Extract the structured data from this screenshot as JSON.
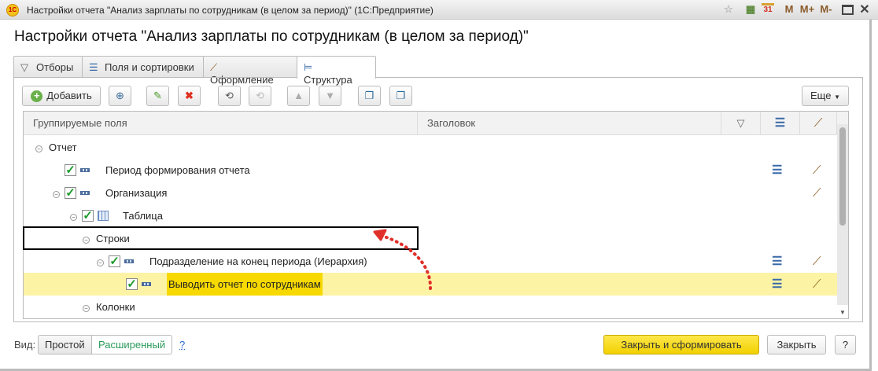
{
  "window": {
    "title": "Настройки отчета \"Анализ зарплаты по сотрудникам (в целом за период)\"  (1С:Предприятие)",
    "logo": "1С",
    "controls": [
      "favorite-icon",
      "calculator-icon",
      "calendar-icon",
      "M",
      "M+",
      "M-",
      "maximize-icon",
      "close-icon"
    ],
    "calendar_day": "31"
  },
  "heading": "Настройки отчета \"Анализ зарплаты по сотрудникам (в целом за период)\"",
  "tabs": [
    {
      "label": "Отборы",
      "icon": "filter-icon"
    },
    {
      "label": "Поля и сортировки",
      "icon": "fields-sort-icon"
    },
    {
      "label": "Оформление",
      "icon": "brush-icon"
    },
    {
      "label": "Структура",
      "icon": "structure-icon",
      "active": true
    }
  ],
  "toolbar": {
    "add_label": "Добавить",
    "more_label": "Еще"
  },
  "table": {
    "columns": [
      "Группируемые поля",
      "Заголовок"
    ],
    "rows": [
      {
        "label": "Отчет",
        "level": 0,
        "expander": true,
        "checkbox": false,
        "icon": "",
        "fields": false,
        "brush": false
      },
      {
        "label": "Период формирования отчета",
        "level": 1,
        "expander": false,
        "checkbox": true,
        "icon": "field",
        "fields": true,
        "brush": true
      },
      {
        "label": "Организация",
        "level": 1,
        "expander": true,
        "checkbox": true,
        "icon": "field",
        "fields": false,
        "brush": true
      },
      {
        "label": "Таблица",
        "level": 2,
        "expander": true,
        "checkbox": true,
        "icon": "table",
        "fields": false,
        "brush": false
      },
      {
        "label": "Строки",
        "level": 3,
        "expander": true,
        "checkbox": false,
        "icon": "",
        "fields": false,
        "brush": false
      },
      {
        "label": "Подразделение на конец периода (Иерархия)",
        "level": 4,
        "expander": true,
        "checkbox": true,
        "icon": "field",
        "fields": true,
        "brush": true
      },
      {
        "label": "Выводить отчет по сотрудникам",
        "level": 5,
        "expander": false,
        "checkbox": true,
        "icon": "field",
        "fields": true,
        "brush": true,
        "selected": true
      },
      {
        "label": "Колонки",
        "level": 3,
        "expander": true,
        "checkbox": false,
        "icon": "",
        "fields": false,
        "brush": false
      }
    ]
  },
  "footer": {
    "view_label": "Вид:",
    "simple": "Простой",
    "extended": "Расширенный",
    "help_link": "?",
    "close_generate": "Закрыть и сформировать",
    "close": "Закрыть",
    "help": "?"
  },
  "colors": {
    "accent_yellow": "#f7d900",
    "selection": "#fdf3a5",
    "annotation_red": "#e0302a"
  }
}
